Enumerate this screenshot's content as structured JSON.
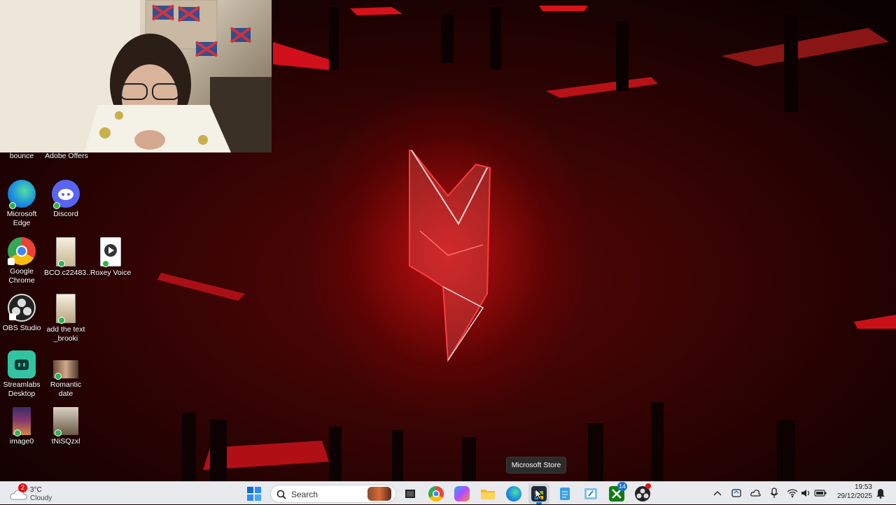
{
  "webcam": {
    "label": "webcam-overlay"
  },
  "desktop_icons": [
    {
      "label": "bounce"
    },
    {
      "label": "Adobe Offers"
    },
    {
      "label": "Microsoft Edge"
    },
    {
      "label": "Discord"
    },
    {
      "label": "Google Chrome"
    },
    {
      "label": "BCO.c22483..."
    },
    {
      "label": "Roxey Voice"
    },
    {
      "label": "OBS Studio"
    },
    {
      "label": "add the text _brooki"
    },
    {
      "label": "Streamlabs Desktop"
    },
    {
      "label": "Romantic date"
    },
    {
      "label": "image0"
    },
    {
      "label": "tNiSQzxl"
    }
  ],
  "tooltip": {
    "text": "Microsoft Store"
  },
  "taskbar": {
    "weather": {
      "temp": "3°C",
      "condition": "Cloudy",
      "badge": "2"
    },
    "search_placeholder": "Search",
    "xbox_badge": "14",
    "clock": {
      "time": "19:53",
      "date": "29/12/2025"
    },
    "icons": [
      "start-icon",
      "search-icon",
      "task-view-icon",
      "chrome-icon",
      "copilot-icon",
      "file-explorer-icon",
      "edge-icon",
      "microsoft-store-icon",
      "notepad-icon",
      "paint-icon",
      "xbox-icon",
      "obs-icon"
    ]
  },
  "colors": {
    "accent": "#e0121b",
    "taskbar": "#e9eaee"
  }
}
